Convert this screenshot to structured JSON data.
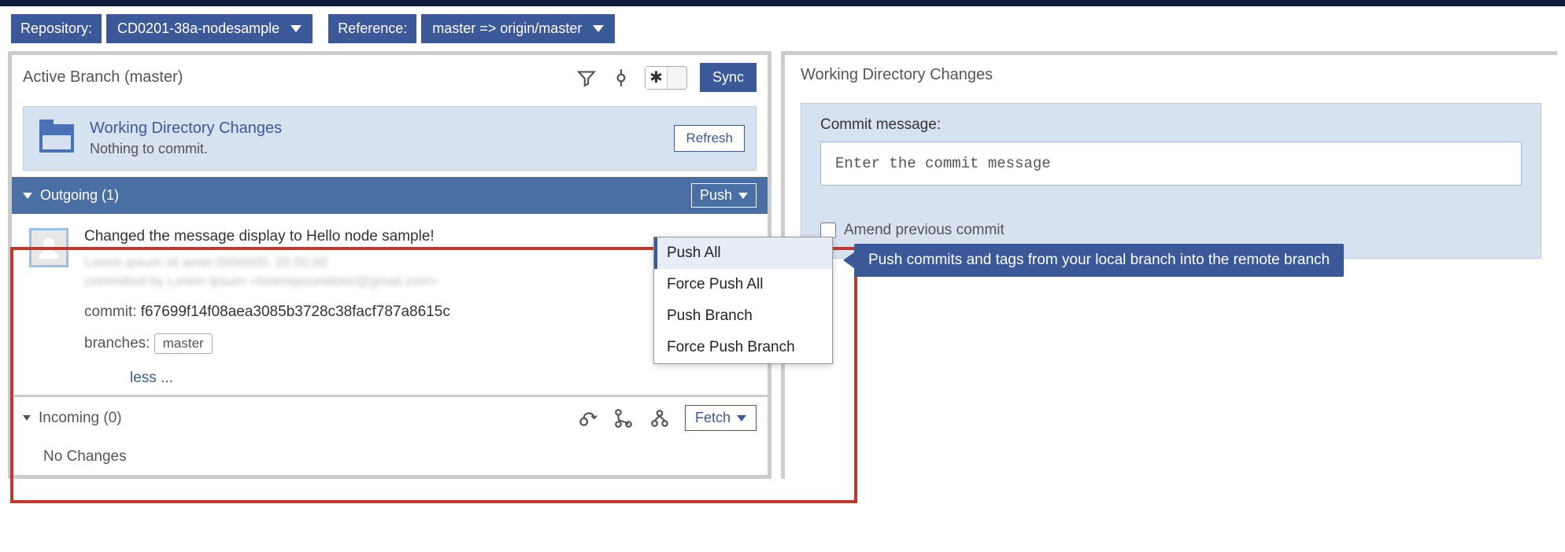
{
  "selectors": {
    "repo_label": "Repository:",
    "repo_value": "CD0201-38a-nodesample",
    "ref_label": "Reference:",
    "ref_value": "master => origin/master"
  },
  "left": {
    "active_branch": "Active Branch (master)",
    "sync": "Sync",
    "wd_title": "Working Directory Changes",
    "wd_sub": "Nothing to commit.",
    "refresh": "Refresh",
    "outgoing_label": "Outgoing (1)",
    "push_label": "Push",
    "commit": {
      "message": "Changed the message display to Hello node sample!",
      "blur1": "Lorem ipsum sit amet 0000000, 00:00:00",
      "blur2": "committed by Lorem Ipsum <loremipsumdolor@gmail.com>",
      "hash_label": "commit:",
      "hash": "f67699f14f08aea3085b3728c38facf787a8615c",
      "branches_label": "branches:",
      "branch": "master",
      "less": "less ..."
    },
    "incoming_label": "Incoming (0)",
    "fetch": "Fetch",
    "no_changes": "No Changes"
  },
  "dropdown": {
    "items": [
      "Push All",
      "Force Push All",
      "Push Branch",
      "Force Push Branch"
    ]
  },
  "tooltip": "Push commits and tags from your local branch into the remote branch",
  "right": {
    "header": "Working Directory Changes",
    "commit_label": "Commit message:",
    "placeholder": "Enter the commit message",
    "amend": "Amend previous commit"
  }
}
